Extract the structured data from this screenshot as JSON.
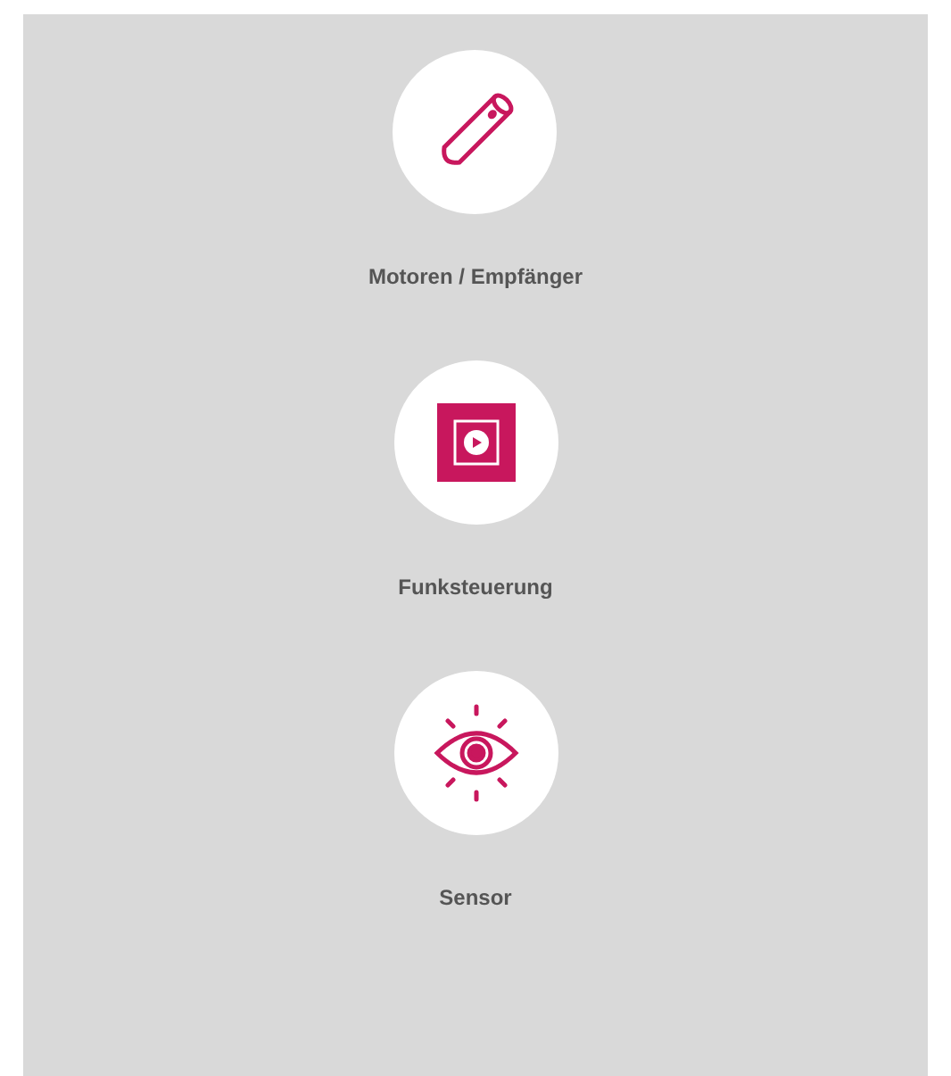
{
  "categories": [
    {
      "label": "Motoren / Empfänger",
      "kind": "tube"
    },
    {
      "label": "Funksteuerung",
      "kind": "remote"
    },
    {
      "label": "Sensor",
      "kind": "eye"
    }
  ]
}
